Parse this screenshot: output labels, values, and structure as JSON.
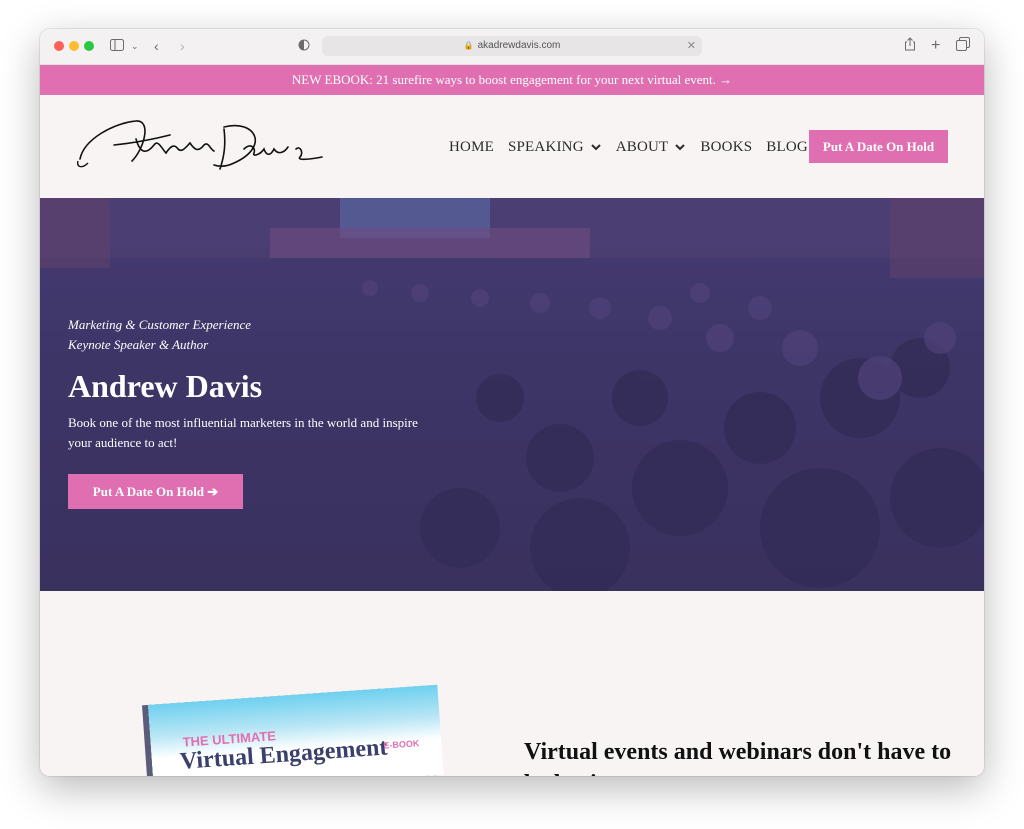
{
  "browser": {
    "url": "akadrewdavis.com"
  },
  "announcement": {
    "text": "NEW EBOOK: 21 surefire ways to boost engagement for your next virtual event. →"
  },
  "header": {
    "logo_text": "Andrew Davis",
    "nav": [
      {
        "label": "HOME",
        "has_dropdown": false
      },
      {
        "label": "SPEAKING",
        "has_dropdown": true
      },
      {
        "label": "ABOUT",
        "has_dropdown": true
      },
      {
        "label": "BOOKS",
        "has_dropdown": false
      },
      {
        "label": "BLOG",
        "has_dropdown": false
      }
    ],
    "cta_label": "Put A Date On Hold"
  },
  "hero": {
    "subtitle_line1": "Marketing & Customer Experience",
    "subtitle_line2": "Keynote Speaker & Author",
    "title": "Andrew Davis",
    "description": "Book one of the most influential marketers in the world and inspire your audience to act!",
    "cta_label": "Put A Date On Hold ➔"
  },
  "lower": {
    "ebook_pre": "THE ULTIMATE",
    "ebook_title": "Virtual Engagement",
    "ebook_tag": "E-BOOK",
    "heading": "Virtual events and webinars don't have to be boring."
  },
  "colors": {
    "accent": "#e06fb1",
    "hero_overlay": "#3f3768",
    "background": "#f8f4f4"
  }
}
